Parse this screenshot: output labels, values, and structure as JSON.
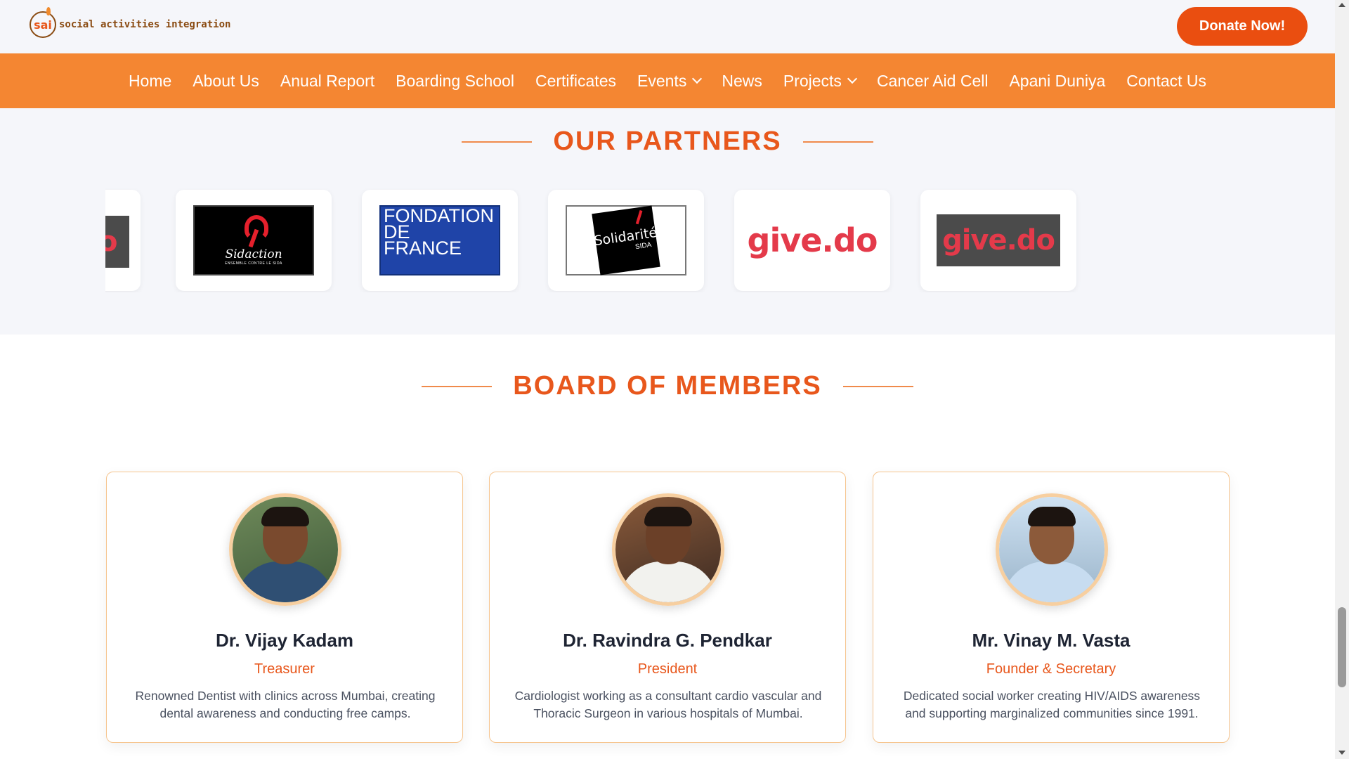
{
  "header": {
    "logo_mark": "sai",
    "logo_text": "social activities integration",
    "donate_label": "Donate Now!"
  },
  "nav": {
    "items": [
      {
        "label": "Home"
      },
      {
        "label": "About Us"
      },
      {
        "label": "Anual Report"
      },
      {
        "label": "Boarding School"
      },
      {
        "label": "Certificates"
      },
      {
        "label": "Events",
        "dropdown": true
      },
      {
        "label": "News"
      },
      {
        "label": "Projects",
        "dropdown": true
      },
      {
        "label": "Cancer Aid Cell"
      },
      {
        "label": "Apani Duniya"
      },
      {
        "label": "Contact Us"
      }
    ]
  },
  "partners": {
    "title": "OUR PARTNERS",
    "logos": [
      {
        "name": "give.do (partial)",
        "text": "o"
      },
      {
        "name": "Sidaction",
        "text": "Sidaction",
        "sub": "ENSEMBLE CONTRE LE SIDA"
      },
      {
        "name": "Fondation de France",
        "lines": [
          "FONDATION",
          "DE",
          "FRANCE"
        ]
      },
      {
        "name": "Solidarité Sida",
        "text": "Solidarité",
        "sub": "SIDA"
      },
      {
        "name": "give.do",
        "text": "give.do"
      },
      {
        "name": "give.do dark",
        "text": "give.do"
      }
    ]
  },
  "board": {
    "title": "BOARD OF MEMBERS",
    "members": [
      {
        "name": "Dr. Vijay Kadam",
        "role": "Treasurer",
        "bio": "Renowned Dentist with clinics across Mumbai, creating dental awareness and conducting free camps."
      },
      {
        "name": "Dr. Ravindra G. Pendkar",
        "role": "President",
        "bio": "Cardiologist working as a consultant cardio vascular and Thoracic Surgeon in various hospitals of Mumbai."
      },
      {
        "name": "Mr. Vinay M. Vasta",
        "role": "Founder & Secretary",
        "bio": "Dedicated social worker creating HIV/AIDS awareness and supporting marginalized communities since 1991."
      }
    ]
  },
  "colors": {
    "accent": "#e8571c",
    "nav_bg": "#f48632",
    "donate_bg": "#ea4e10",
    "section_bg": "#f5f6fa"
  }
}
